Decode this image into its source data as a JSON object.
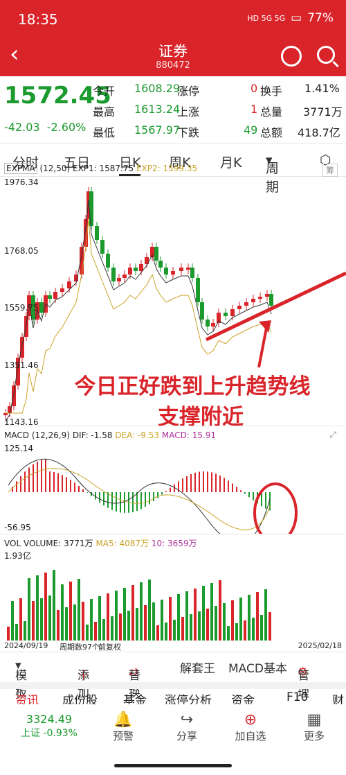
{
  "status": {
    "time": "18:35",
    "battery": "77%",
    "signal": "HD 5G 5G"
  },
  "nav": {
    "title": "证券",
    "code": "880472"
  },
  "quote": {
    "price": "1572.45",
    "change": "-42.03",
    "change_pct": "-2.60%",
    "open_label": "今开",
    "open": "1608.29",
    "high_label": "最高",
    "high": "1613.24",
    "low_label": "最低",
    "low": "1567.97",
    "limit_up_label": "涨停",
    "limit_up": "0",
    "rise_label": "上涨",
    "rise": "1",
    "fall_label": "下跌",
    "fall": "49",
    "turnover_label": "换手",
    "turnover": "1.41%",
    "volume_label": "总量",
    "volume": "3771万",
    "amount_label": "总额",
    "amount": "418.7亿"
  },
  "tabs": [
    "分时",
    "五日",
    "日K",
    "周K",
    "月K",
    "周期"
  ],
  "indicator": {
    "name": "EXPMA",
    "params": "(12,50)",
    "exp1": "EXP1: 1587.75",
    "exp2": "EXP2: 1599.35",
    "fuquan": "筹",
    "y_ticks": [
      "1976.34",
      "1768.05",
      "1559.75",
      "1351.46",
      "1143.16"
    ]
  },
  "macd": {
    "name": "MACD",
    "params": "(12,26,9)",
    "dif": "DIF: -1.58",
    "dea": "DEA: -9.53",
    "macd": "MACD: 15.91",
    "y_ticks": [
      "125.14",
      "-56.95"
    ]
  },
  "vol": {
    "name": "VOL",
    "volume": "VOLUME: 3771万",
    "ma5": "MA5: 4087万",
    "ma10": "10: 3659万",
    "y_tick": "1.93亿",
    "x_start": "2024/09/19",
    "x_mid": "周期数97个",
    "x_adj": "前复权",
    "x_end": "2025/02/18"
  },
  "annotation": {
    "line1": "今日正好跌到上升趋势线",
    "line2": "支撑附近"
  },
  "toolbar": [
    "模板",
    "添加",
    "替换",
    "解套王",
    "MACD基本",
    "管理"
  ],
  "subtabs": [
    "资讯",
    "成份股",
    "基金",
    "涨停分析",
    "资金",
    "F10",
    "财"
  ],
  "bottom": {
    "index_value": "3324.49",
    "index_label": "上证 -0.93%",
    "items": [
      "预警",
      "分享",
      "加自选",
      "更多"
    ]
  },
  "colors": {
    "up": "#d9242a",
    "down": "#1b9a2d",
    "exp1": "#333333",
    "exp2": "#c9a227"
  },
  "chart_data": {
    "type": "candlestick",
    "series": [
      {
        "name": "EXP1",
        "values": [
          1587.75
        ]
      },
      {
        "name": "EXP2",
        "values": [
          1599.35
        ]
      }
    ],
    "ylim": [
      1143.16,
      1976.34
    ]
  }
}
